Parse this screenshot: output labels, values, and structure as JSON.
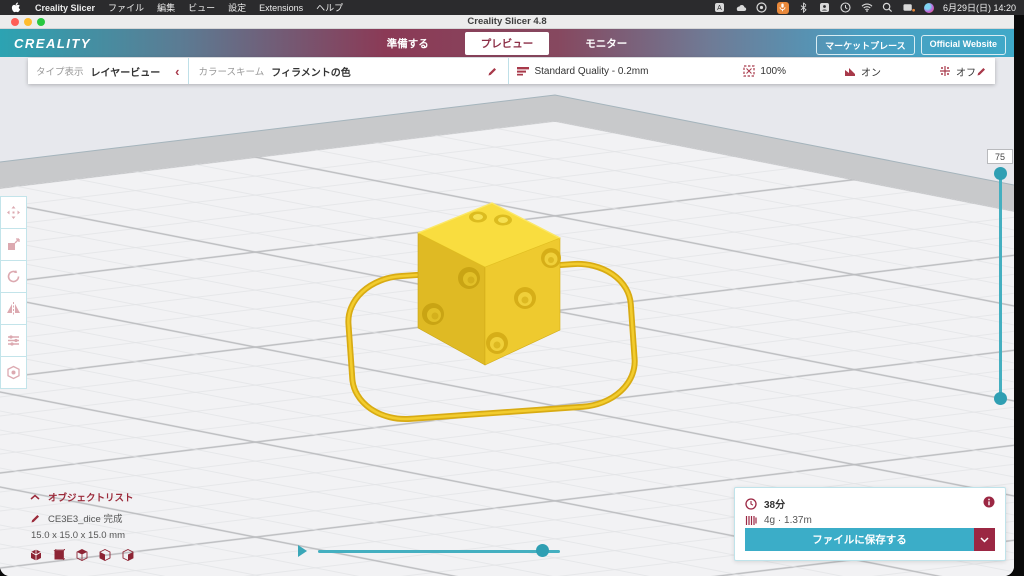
{
  "menubar": {
    "app_name": "Creality Slicer",
    "items": [
      "ファイル",
      "編集",
      "ビュー",
      "設定",
      "Extensions",
      "ヘルプ"
    ],
    "datetime": "6月29日(日) 14:20"
  },
  "titlebar": {
    "title": "Creality Slicer 4.8"
  },
  "header": {
    "logo": "CREALITY",
    "tabs": [
      {
        "label": "準備する",
        "active": false
      },
      {
        "label": "プレビュー",
        "active": true
      },
      {
        "label": "モニター",
        "active": false
      }
    ],
    "marketplace_label": "マーケットプレース",
    "official_label": "Official Website"
  },
  "toolbar": {
    "view_type_label": "タイプ表示",
    "view_type_value": "レイヤービュー",
    "scheme_label": "カラースキーム",
    "scheme_value": "フィラメントの色",
    "profile": "Standard Quality - 0.2mm",
    "infill": "100%",
    "support": "オン",
    "adhesion": "オフ"
  },
  "layer_slider": {
    "value": "75"
  },
  "object_list": {
    "title": "オブジェクトリスト",
    "name": "CE3E3_dice 完成",
    "dims": "15.0 x 15.0 x 15.0 mm"
  },
  "print_info": {
    "time": "38分",
    "material": "4g · 1.37m",
    "save_label": "ファイルに保存する"
  },
  "colors": {
    "accent_teal": "#3badc8",
    "accent_maroon": "#9b2743",
    "icon_red": "#a8394a",
    "model_yellow": "#f2cc2e"
  }
}
